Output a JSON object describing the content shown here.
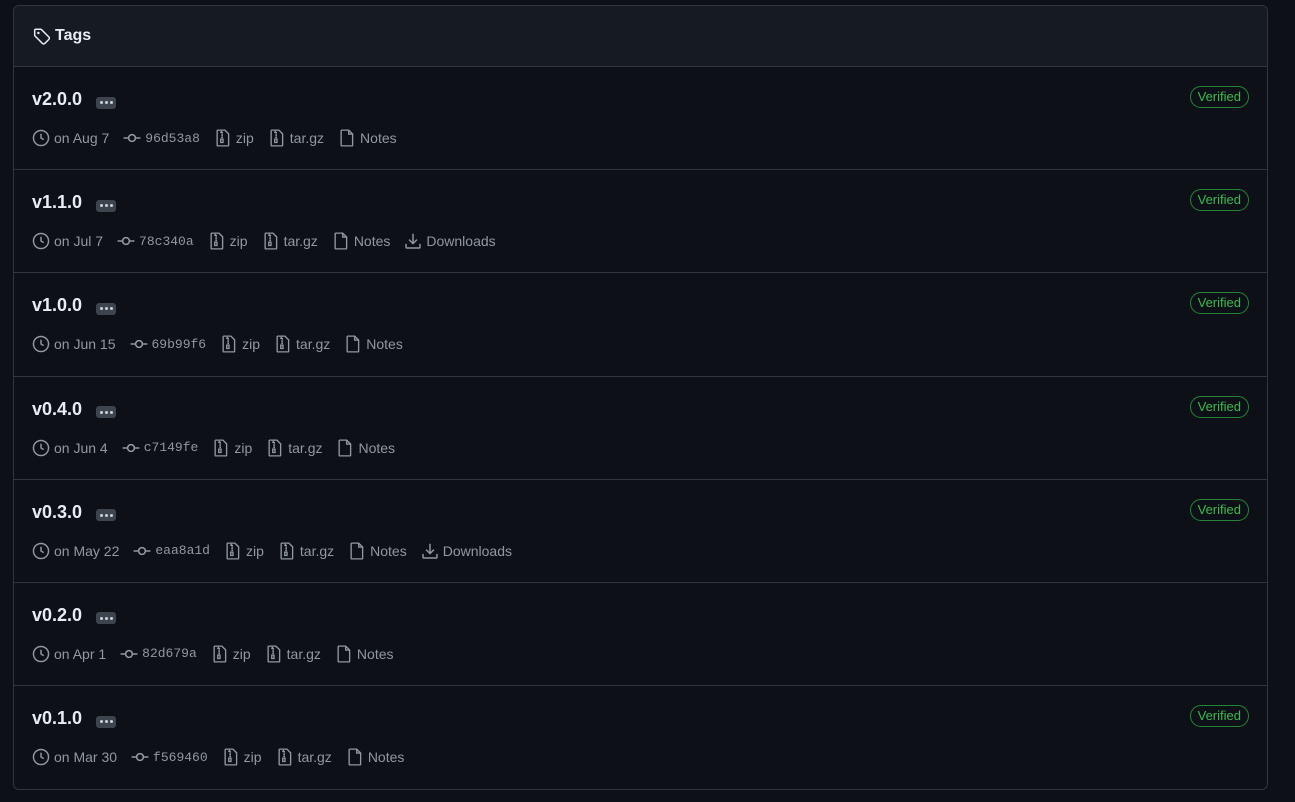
{
  "header": {
    "title": "Tags",
    "icon": "tag-icon"
  },
  "tags": [
    {
      "name": "v2.0.0",
      "date": "on Aug 7",
      "sha": "96d53a8",
      "zip": "zip",
      "targz": "tar.gz",
      "notes": "Notes",
      "downloads": null,
      "verified": "Verified"
    },
    {
      "name": "v1.1.0",
      "date": "on Jul 7",
      "sha": "78c340a",
      "zip": "zip",
      "targz": "tar.gz",
      "notes": "Notes",
      "downloads": "Downloads",
      "verified": "Verified"
    },
    {
      "name": "v1.0.0",
      "date": "on Jun 15",
      "sha": "69b99f6",
      "zip": "zip",
      "targz": "tar.gz",
      "notes": "Notes",
      "downloads": null,
      "verified": "Verified"
    },
    {
      "name": "v0.4.0",
      "date": "on Jun 4",
      "sha": "c7149fe",
      "zip": "zip",
      "targz": "tar.gz",
      "notes": "Notes",
      "downloads": null,
      "verified": "Verified"
    },
    {
      "name": "v0.3.0",
      "date": "on May 22",
      "sha": "eaa8a1d",
      "zip": "zip",
      "targz": "tar.gz",
      "notes": "Notes",
      "downloads": "Downloads",
      "verified": "Verified"
    },
    {
      "name": "v0.2.0",
      "date": "on Apr 1",
      "sha": "82d679a",
      "zip": "zip",
      "targz": "tar.gz",
      "notes": "Notes",
      "downloads": null,
      "verified": null
    },
    {
      "name": "v0.1.0",
      "date": "on Mar 30",
      "sha": "f569460",
      "zip": "zip",
      "targz": "tar.gz",
      "notes": "Notes",
      "downloads": null,
      "verified": "Verified"
    }
  ],
  "colors": {
    "background": "#0d1117",
    "header_bg": "#161b22",
    "border": "#30363d",
    "verified_green": "#3fb950",
    "muted_text": "#9198a1"
  }
}
